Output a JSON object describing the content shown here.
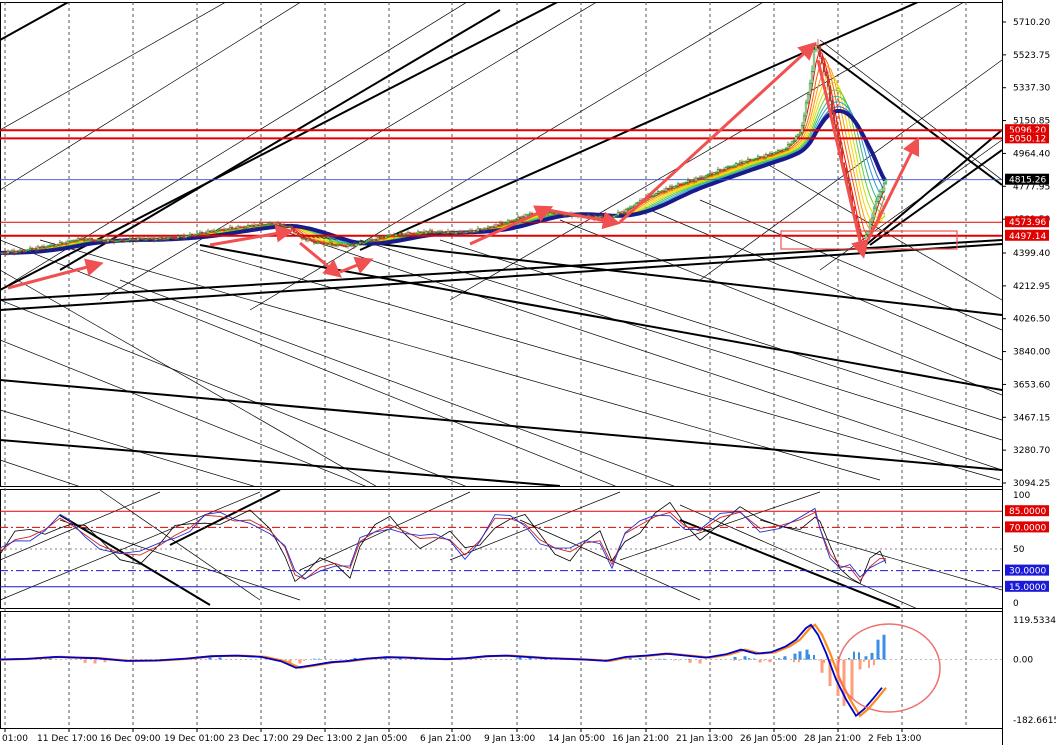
{
  "chart_data": {
    "type": "candlestick",
    "symbol_note": "",
    "main_axis": {
      "ticks": [
        "5710.20",
        "5523.75",
        "5337.30",
        "5150.85",
        "4964.40",
        "4777.95",
        "4591.50",
        "4399.40",
        "4212.95",
        "4026.50",
        "3840.00",
        "3653.60",
        "3467.15",
        "3280.70",
        "3094.25"
      ],
      "range": [
        3094.25,
        5710.2
      ]
    },
    "x_labels": [
      "01:00",
      "11 Dec 17:00",
      "16 Dec 09:00",
      "19 Dec 01:00",
      "23 Dec 17:00",
      "29 Dec 13:00",
      "2 Jan 05:00",
      "6 Jan 21:00",
      "9 Jan 13:00",
      "14 Jan 05:00",
      "16 Jan 21:00",
      "21 Jan 13:00",
      "26 Jan 05:00",
      "28 Jan 21:00",
      "2 Feb 13:00"
    ],
    "horizontal_levels": [
      {
        "label": "5096.20",
        "value": 5096.2,
        "color": "#e00000",
        "style": "thick"
      },
      {
        "label": "5050.12",
        "value": 5050.12,
        "color": "#e00000",
        "style": "thick"
      },
      {
        "label": "4573.96",
        "value": 4573.96,
        "color": "#e00000",
        "style": "thin"
      },
      {
        "label": "4497.14",
        "value": 4497.14,
        "color": "#e00000",
        "style": "thick"
      }
    ],
    "current_price": {
      "label": "4815.26",
      "value": 4815.26
    },
    "price_path": [
      [
        0,
        4400
      ],
      [
        20,
        4410
      ],
      [
        40,
        4430
      ],
      [
        60,
        4450
      ],
      [
        80,
        4480
      ],
      [
        100,
        4470
      ],
      [
        120,
        4470
      ],
      [
        140,
        4480
      ],
      [
        160,
        4480
      ],
      [
        180,
        4490
      ],
      [
        200,
        4510
      ],
      [
        220,
        4530
      ],
      [
        240,
        4545
      ],
      [
        260,
        4560
      ],
      [
        275,
        4565
      ],
      [
        290,
        4545
      ],
      [
        300,
        4490
      ],
      [
        315,
        4460
      ],
      [
        335,
        4445
      ],
      [
        350,
        4440
      ],
      [
        370,
        4470
      ],
      [
        390,
        4500
      ],
      [
        410,
        4510
      ],
      [
        430,
        4520
      ],
      [
        450,
        4515
      ],
      [
        470,
        4520
      ],
      [
        490,
        4545
      ],
      [
        510,
        4580
      ],
      [
        530,
        4620
      ],
      [
        550,
        4630
      ],
      [
        570,
        4615
      ],
      [
        590,
        4605
      ],
      [
        610,
        4600
      ],
      [
        625,
        4640
      ],
      [
        645,
        4710
      ],
      [
        665,
        4760
      ],
      [
        685,
        4800
      ],
      [
        705,
        4835
      ],
      [
        725,
        4880
      ],
      [
        745,
        4920
      ],
      [
        765,
        4950
      ],
      [
        785,
        4990
      ],
      [
        800,
        5080
      ],
      [
        810,
        5350
      ],
      [
        815,
        5600
      ],
      [
        820,
        5520
      ],
      [
        826,
        5400
      ],
      [
        832,
        5200
      ],
      [
        840,
        4980
      ],
      [
        848,
        4780
      ],
      [
        856,
        4560
      ],
      [
        862,
        4420
      ],
      [
        868,
        4520
      ],
      [
        874,
        4660
      ],
      [
        880,
        4740
      ],
      [
        886,
        4820
      ]
    ],
    "oscillator": {
      "range": [
        0,
        100
      ],
      "ticks": [
        "100",
        "85.0000",
        "70.0000",
        "50",
        "30.0000",
        "15.0000",
        "0"
      ],
      "levels": [
        {
          "label": "85.0000",
          "value": 85,
          "color": "#e00000",
          "style": "solid"
        },
        {
          "label": "70.0000",
          "value": 70,
          "color": "#e00000",
          "style": "dashdot"
        },
        {
          "label": "30.0000",
          "value": 30,
          "color": "#1a1ad8",
          "style": "dashdot"
        },
        {
          "label": "15.0000",
          "value": 15,
          "color": "#1a1ad8",
          "style": "solid"
        }
      ],
      "series_points": [
        [
          0,
          45
        ],
        [
          15,
          55
        ],
        [
          30,
          62
        ],
        [
          45,
          72
        ],
        [
          60,
          80
        ],
        [
          70,
          70
        ],
        [
          85,
          60
        ],
        [
          100,
          55
        ],
        [
          120,
          50
        ],
        [
          140,
          45
        ],
        [
          160,
          50
        ],
        [
          175,
          60
        ],
        [
          190,
          72
        ],
        [
          205,
          85
        ],
        [
          220,
          80
        ],
        [
          235,
          72
        ],
        [
          250,
          75
        ],
        [
          270,
          70
        ],
        [
          285,
          55
        ],
        [
          295,
          25
        ],
        [
          305,
          18
        ],
        [
          320,
          32
        ],
        [
          335,
          40
        ],
        [
          350,
          35
        ],
        [
          360,
          55
        ],
        [
          375,
          62
        ],
        [
          390,
          72
        ],
        [
          405,
          70
        ],
        [
          420,
          62
        ],
        [
          435,
          58
        ],
        [
          450,
          55
        ],
        [
          465,
          45
        ],
        [
          480,
          62
        ],
        [
          495,
          80
        ],
        [
          510,
          75
        ],
        [
          525,
          70
        ],
        [
          540,
          60
        ],
        [
          555,
          55
        ],
        [
          570,
          48
        ],
        [
          585,
          52
        ],
        [
          600,
          55
        ],
        [
          612,
          38
        ],
        [
          625,
          68
        ],
        [
          640,
          72
        ],
        [
          655,
          76
        ],
        [
          670,
          82
        ],
        [
          685,
          74
        ],
        [
          700,
          70
        ],
        [
          720,
          78
        ],
        [
          740,
          80
        ],
        [
          760,
          68
        ],
        [
          780,
          75
        ],
        [
          800,
          80
        ],
        [
          815,
          82
        ],
        [
          820,
          65
        ],
        [
          830,
          45
        ],
        [
          840,
          38
        ],
        [
          850,
          35
        ],
        [
          860,
          18
        ],
        [
          870,
          30
        ],
        [
          880,
          42
        ],
        [
          886,
          45
        ]
      ]
    },
    "macd": {
      "range": [
        -182.6615,
        119.5334
      ],
      "ticks": [
        "119.5334",
        "0.00",
        "-182.6615"
      ],
      "line_points": [
        [
          0,
          0
        ],
        [
          30,
          2
        ],
        [
          60,
          8
        ],
        [
          80,
          6
        ],
        [
          100,
          4
        ],
        [
          130,
          -4
        ],
        [
          160,
          -3
        ],
        [
          190,
          3
        ],
        [
          215,
          10
        ],
        [
          240,
          12
        ],
        [
          265,
          8
        ],
        [
          285,
          -5
        ],
        [
          300,
          -25
        ],
        [
          315,
          -18
        ],
        [
          335,
          -8
        ],
        [
          350,
          -5
        ],
        [
          370,
          3
        ],
        [
          390,
          7
        ],
        [
          410,
          6
        ],
        [
          430,
          3
        ],
        [
          450,
          1
        ],
        [
          470,
          4
        ],
        [
          490,
          10
        ],
        [
          510,
          12
        ],
        [
          530,
          8
        ],
        [
          550,
          4
        ],
        [
          570,
          2
        ],
        [
          590,
          0
        ],
        [
          610,
          -4
        ],
        [
          630,
          8
        ],
        [
          650,
          12
        ],
        [
          670,
          18
        ],
        [
          690,
          12
        ],
        [
          710,
          6
        ],
        [
          730,
          16
        ],
        [
          745,
          30
        ],
        [
          760,
          18
        ],
        [
          775,
          22
        ],
        [
          790,
          40
        ],
        [
          800,
          60
        ],
        [
          810,
          95
        ],
        [
          815,
          105
        ],
        [
          822,
          75
        ],
        [
          830,
          20
        ],
        [
          840,
          -60
        ],
        [
          850,
          -120
        ],
        [
          860,
          -170
        ],
        [
          868,
          -150
        ],
        [
          878,
          -115
        ],
        [
          886,
          -85
        ]
      ],
      "histogram": [
        [
          40,
          6
        ],
        [
          50,
          8
        ],
        [
          85,
          -10
        ],
        [
          95,
          -12
        ],
        [
          105,
          -8
        ],
        [
          195,
          4
        ],
        [
          210,
          7
        ],
        [
          220,
          6
        ],
        [
          290,
          -15
        ],
        [
          300,
          -12
        ],
        [
          355,
          5
        ],
        [
          370,
          6
        ],
        [
          385,
          8
        ],
        [
          400,
          6
        ],
        [
          415,
          5
        ],
        [
          440,
          3
        ],
        [
          460,
          -2
        ],
        [
          520,
          8
        ],
        [
          530,
          6
        ],
        [
          545,
          3
        ],
        [
          615,
          -4
        ],
        [
          630,
          5
        ],
        [
          640,
          4
        ],
        [
          690,
          -10
        ],
        [
          700,
          -12
        ],
        [
          735,
          8
        ],
        [
          745,
          10
        ],
        [
          760,
          -9
        ],
        [
          770,
          -8
        ],
        [
          785,
          10
        ],
        [
          795,
          18
        ],
        [
          800,
          25
        ],
        [
          807,
          30
        ],
        [
          822,
          -40
        ],
        [
          830,
          -80
        ],
        [
          838,
          -110
        ],
        [
          844,
          -140
        ],
        [
          852,
          -120
        ],
        [
          860,
          -30
        ],
        [
          866,
          10
        ],
        [
          872,
          20
        ],
        [
          878,
          60
        ],
        [
          884,
          75
        ]
      ]
    },
    "colors": {
      "bull_candle": "#1e8a1e",
      "bear_candle": "#c0392b",
      "ribbon_base": "#1a1a8c",
      "level_red": "#e00000",
      "level_blue": "#1a1ad8",
      "macd_line": "#ff8c1a",
      "macd_signal": "#0000c8",
      "hist_pos": "#3a8ee6",
      "hist_neg": "#ff9e7a",
      "arrow_red": "#f05050"
    }
  }
}
